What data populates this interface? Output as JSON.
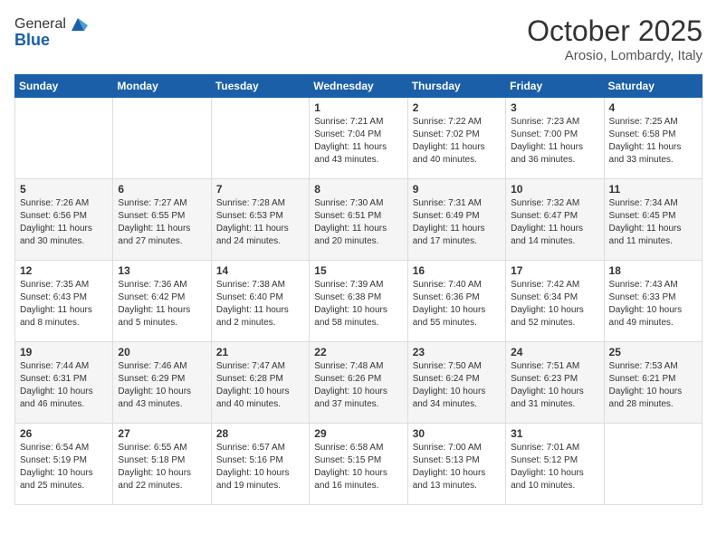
{
  "logo": {
    "general": "General",
    "blue": "Blue"
  },
  "header": {
    "month": "October 2025",
    "location": "Arosio, Lombardy, Italy"
  },
  "days_of_week": [
    "Sunday",
    "Monday",
    "Tuesday",
    "Wednesday",
    "Thursday",
    "Friday",
    "Saturday"
  ],
  "weeks": [
    [
      {
        "day": "",
        "info": ""
      },
      {
        "day": "",
        "info": ""
      },
      {
        "day": "",
        "info": ""
      },
      {
        "day": "1",
        "info": "Sunrise: 7:21 AM\nSunset: 7:04 PM\nDaylight: 11 hours\nand 43 minutes."
      },
      {
        "day": "2",
        "info": "Sunrise: 7:22 AM\nSunset: 7:02 PM\nDaylight: 11 hours\nand 40 minutes."
      },
      {
        "day": "3",
        "info": "Sunrise: 7:23 AM\nSunset: 7:00 PM\nDaylight: 11 hours\nand 36 minutes."
      },
      {
        "day": "4",
        "info": "Sunrise: 7:25 AM\nSunset: 6:58 PM\nDaylight: 11 hours\nand 33 minutes."
      }
    ],
    [
      {
        "day": "5",
        "info": "Sunrise: 7:26 AM\nSunset: 6:56 PM\nDaylight: 11 hours\nand 30 minutes."
      },
      {
        "day": "6",
        "info": "Sunrise: 7:27 AM\nSunset: 6:55 PM\nDaylight: 11 hours\nand 27 minutes."
      },
      {
        "day": "7",
        "info": "Sunrise: 7:28 AM\nSunset: 6:53 PM\nDaylight: 11 hours\nand 24 minutes."
      },
      {
        "day": "8",
        "info": "Sunrise: 7:30 AM\nSunset: 6:51 PM\nDaylight: 11 hours\nand 20 minutes."
      },
      {
        "day": "9",
        "info": "Sunrise: 7:31 AM\nSunset: 6:49 PM\nDaylight: 11 hours\nand 17 minutes."
      },
      {
        "day": "10",
        "info": "Sunrise: 7:32 AM\nSunset: 6:47 PM\nDaylight: 11 hours\nand 14 minutes."
      },
      {
        "day": "11",
        "info": "Sunrise: 7:34 AM\nSunset: 6:45 PM\nDaylight: 11 hours\nand 11 minutes."
      }
    ],
    [
      {
        "day": "12",
        "info": "Sunrise: 7:35 AM\nSunset: 6:43 PM\nDaylight: 11 hours\nand 8 minutes."
      },
      {
        "day": "13",
        "info": "Sunrise: 7:36 AM\nSunset: 6:42 PM\nDaylight: 11 hours\nand 5 minutes."
      },
      {
        "day": "14",
        "info": "Sunrise: 7:38 AM\nSunset: 6:40 PM\nDaylight: 11 hours\nand 2 minutes."
      },
      {
        "day": "15",
        "info": "Sunrise: 7:39 AM\nSunset: 6:38 PM\nDaylight: 10 hours\nand 58 minutes."
      },
      {
        "day": "16",
        "info": "Sunrise: 7:40 AM\nSunset: 6:36 PM\nDaylight: 10 hours\nand 55 minutes."
      },
      {
        "day": "17",
        "info": "Sunrise: 7:42 AM\nSunset: 6:34 PM\nDaylight: 10 hours\nand 52 minutes."
      },
      {
        "day": "18",
        "info": "Sunrise: 7:43 AM\nSunset: 6:33 PM\nDaylight: 10 hours\nand 49 minutes."
      }
    ],
    [
      {
        "day": "19",
        "info": "Sunrise: 7:44 AM\nSunset: 6:31 PM\nDaylight: 10 hours\nand 46 minutes."
      },
      {
        "day": "20",
        "info": "Sunrise: 7:46 AM\nSunset: 6:29 PM\nDaylight: 10 hours\nand 43 minutes."
      },
      {
        "day": "21",
        "info": "Sunrise: 7:47 AM\nSunset: 6:28 PM\nDaylight: 10 hours\nand 40 minutes."
      },
      {
        "day": "22",
        "info": "Sunrise: 7:48 AM\nSunset: 6:26 PM\nDaylight: 10 hours\nand 37 minutes."
      },
      {
        "day": "23",
        "info": "Sunrise: 7:50 AM\nSunset: 6:24 PM\nDaylight: 10 hours\nand 34 minutes."
      },
      {
        "day": "24",
        "info": "Sunrise: 7:51 AM\nSunset: 6:23 PM\nDaylight: 10 hours\nand 31 minutes."
      },
      {
        "day": "25",
        "info": "Sunrise: 7:53 AM\nSunset: 6:21 PM\nDaylight: 10 hours\nand 28 minutes."
      }
    ],
    [
      {
        "day": "26",
        "info": "Sunrise: 6:54 AM\nSunset: 5:19 PM\nDaylight: 10 hours\nand 25 minutes."
      },
      {
        "day": "27",
        "info": "Sunrise: 6:55 AM\nSunset: 5:18 PM\nDaylight: 10 hours\nand 22 minutes."
      },
      {
        "day": "28",
        "info": "Sunrise: 6:57 AM\nSunset: 5:16 PM\nDaylight: 10 hours\nand 19 minutes."
      },
      {
        "day": "29",
        "info": "Sunrise: 6:58 AM\nSunset: 5:15 PM\nDaylight: 10 hours\nand 16 minutes."
      },
      {
        "day": "30",
        "info": "Sunrise: 7:00 AM\nSunset: 5:13 PM\nDaylight: 10 hours\nand 13 minutes."
      },
      {
        "day": "31",
        "info": "Sunrise: 7:01 AM\nSunset: 5:12 PM\nDaylight: 10 hours\nand 10 minutes."
      },
      {
        "day": "",
        "info": ""
      }
    ]
  ]
}
